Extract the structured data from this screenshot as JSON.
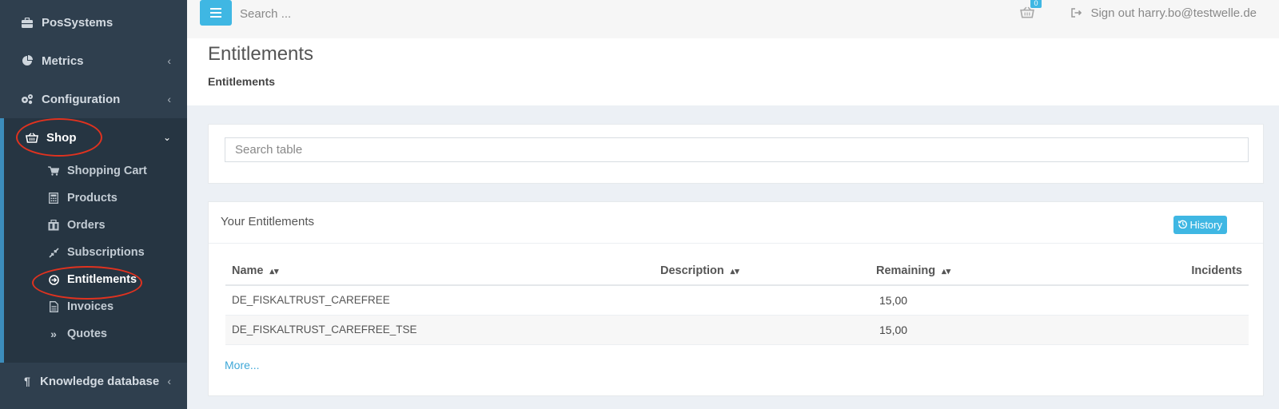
{
  "sidebar": {
    "top_items": [
      {
        "label": "PosSystems",
        "icon": "briefcase-icon"
      },
      {
        "label": "Metrics",
        "icon": "pie-chart-icon"
      },
      {
        "label": "Configuration",
        "icon": "gears-icon"
      }
    ],
    "shop": {
      "label": "Shop",
      "icon": "basket-icon"
    },
    "shop_items": [
      {
        "label": "Shopping Cart",
        "icon": "cart-icon"
      },
      {
        "label": "Products",
        "icon": "calculator-icon"
      },
      {
        "label": "Orders",
        "icon": "orders-icon"
      },
      {
        "label": "Subscriptions",
        "icon": "compress-icon"
      },
      {
        "label": "Entitlements",
        "icon": "circle-arrow-icon"
      },
      {
        "label": "Invoices",
        "icon": "file-icon"
      },
      {
        "label": "Quotes",
        "icon": "double-chevron-icon"
      }
    ],
    "knowledge": {
      "label": "Knowledge database",
      "icon": "paragraph-icon"
    }
  },
  "topbar": {
    "search_placeholder": "Search ...",
    "cart_count": "0",
    "signout_label": "Sign out harry.bo@testwelle.de"
  },
  "page": {
    "title": "Entitlements",
    "breadcrumb": "Entitlements"
  },
  "search_card": {
    "placeholder": "Search table"
  },
  "entitlements_card": {
    "title": "Your Entitlements",
    "history_label": "History",
    "columns": [
      "Name",
      "Description",
      "Remaining",
      "Incidents"
    ],
    "rows": [
      {
        "name": "DE_FISKALTRUST_CAREFREE",
        "description": "",
        "remaining": "15,00",
        "incidents": ""
      },
      {
        "name": "DE_FISKALTRUST_CAREFREE_TSE",
        "description": "",
        "remaining": "15,00",
        "incidents": ""
      }
    ],
    "more_label": "More..."
  },
  "colors": {
    "accent": "#3fb7e3",
    "sidebar_bg": "#2f3f4e",
    "annotation": "#e0321f"
  }
}
